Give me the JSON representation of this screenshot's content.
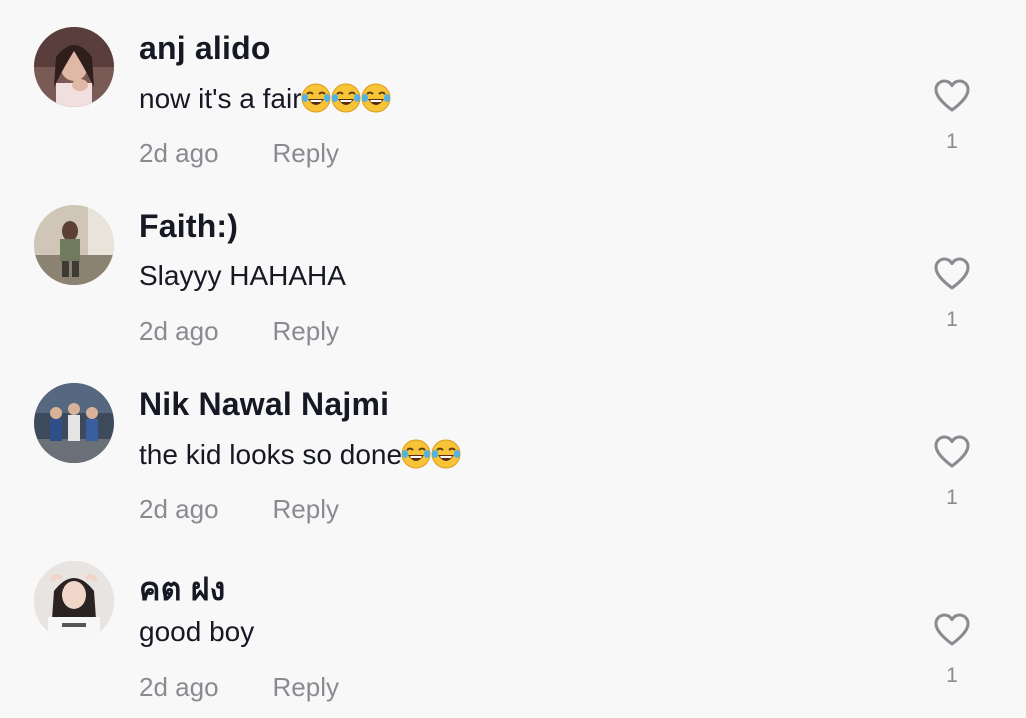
{
  "comments": [
    {
      "username": "anj alido",
      "text": "now it's a fair",
      "emojis": [
        "face-with-tears-of-joy",
        "face-with-tears-of-joy",
        "face-with-tears-of-joy"
      ],
      "time": "2d ago",
      "reply_label": "Reply",
      "likes": "1"
    },
    {
      "username": "Faith:)",
      "text": "Slayyy HAHAHA",
      "emojis": [],
      "time": "2d ago",
      "reply_label": "Reply",
      "likes": "1"
    },
    {
      "username": "Nik Nawal Najmi",
      "text": "the kid looks so done",
      "emojis": [
        "face-with-tears-of-joy",
        "face-with-tears-of-joy"
      ],
      "time": "2d ago",
      "reply_label": "Reply",
      "likes": "1"
    },
    {
      "username": "คต ฝง",
      "text": "good boy",
      "emojis": [],
      "time": "2d ago",
      "reply_label": "Reply",
      "likes": "1"
    }
  ],
  "icons": {
    "like": "heart-outline-icon",
    "emoji": "face-with-tears-of-joy"
  },
  "colors": {
    "background": "#f8f8f8",
    "primary_text": "#161823",
    "secondary_text": "#8a8b91",
    "heart_stroke": "#8a8b91"
  }
}
